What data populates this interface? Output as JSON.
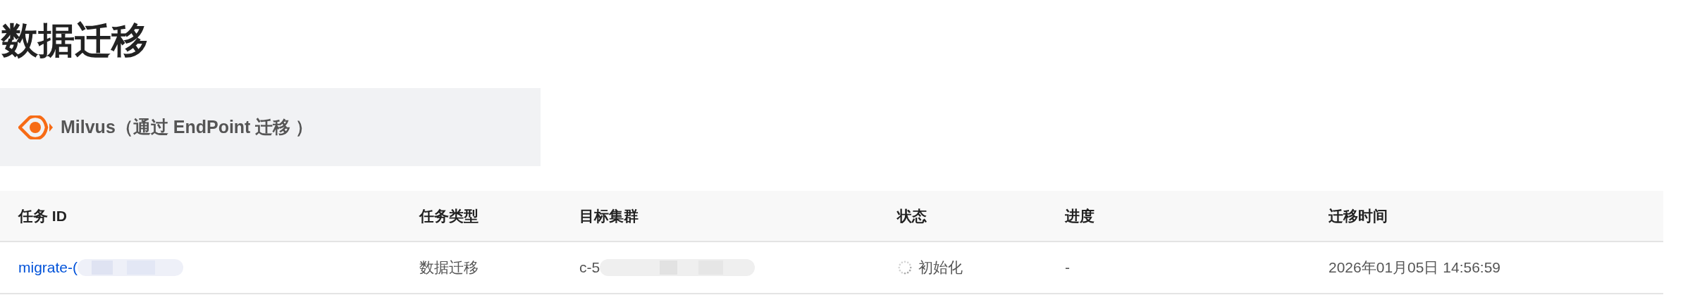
{
  "page_title": "数据迁移",
  "source_card": {
    "label": "Milvus（通过 EndPoint 迁移 ）"
  },
  "table": {
    "columns": [
      "任务 ID",
      "任务类型",
      "目标集群",
      "状态",
      "进度",
      "迁移时间"
    ],
    "rows": [
      {
        "task_id": "migrate-(",
        "task_type": "数据迁移",
        "target_cluster": "c-5",
        "status": {
          "kind": "loading",
          "label": "初始化"
        },
        "progress": "-",
        "time": "2026年01月05日 14:56:59"
      }
    ]
  }
}
